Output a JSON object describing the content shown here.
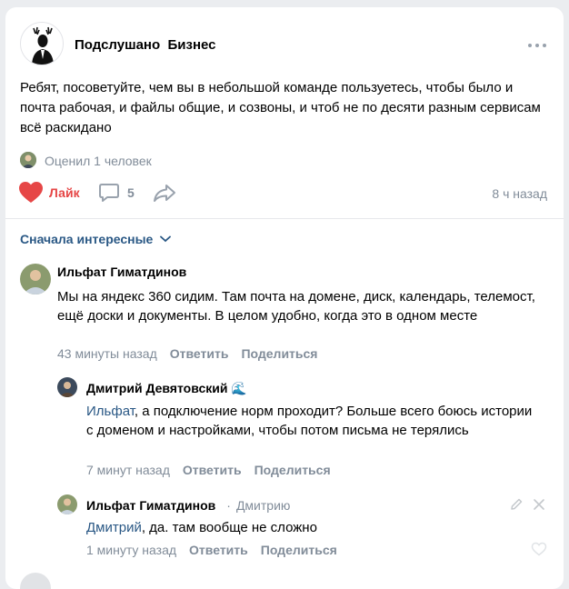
{
  "post": {
    "group_name": "Подслушано  Бизнес",
    "text": "Ребят, посоветуйте, чем вы в небольшой команде пользуетесь, чтобы было и почта рабочая, и файлы общие, и созвоны, и чтоб не по десяти разным сервисам всё раскидано",
    "rated_by": "Оценил 1 человек",
    "like_label": "Лайк",
    "comments_count": "5",
    "time": "8 ч назад"
  },
  "comments": {
    "sort_label": "Сначала интересные",
    "reply_label": "Ответить",
    "share_label": "Поделиться",
    "items": [
      {
        "author": "Ильфат Гиматдинов",
        "text": "Мы на яндекс 360 сидим. Там почта на домене, диск, календарь, телемост, ещё доски и документы. В целом удобно, когда это в одном месте",
        "time": "43 минуты назад"
      },
      {
        "author": "Дмитрий Девятовский",
        "author_emoji": "🌊",
        "mention": "Ильфат",
        "text": ", а подключение норм проходит? Больше всего боюсь истории с доменом и настройками, чтобы потом письма не терялись",
        "time": "7 минут назад"
      },
      {
        "author": "Ильфат Гиматдинов",
        "reply_to": "Дмитрию",
        "mention": "Дмитрий",
        "text": ", да. там вообще не сложно",
        "time": "1 минуту назад"
      }
    ]
  },
  "colors": {
    "like": "#e64646",
    "link": "#2a5885",
    "muted": "#818c99",
    "background": "#ebedf0"
  }
}
